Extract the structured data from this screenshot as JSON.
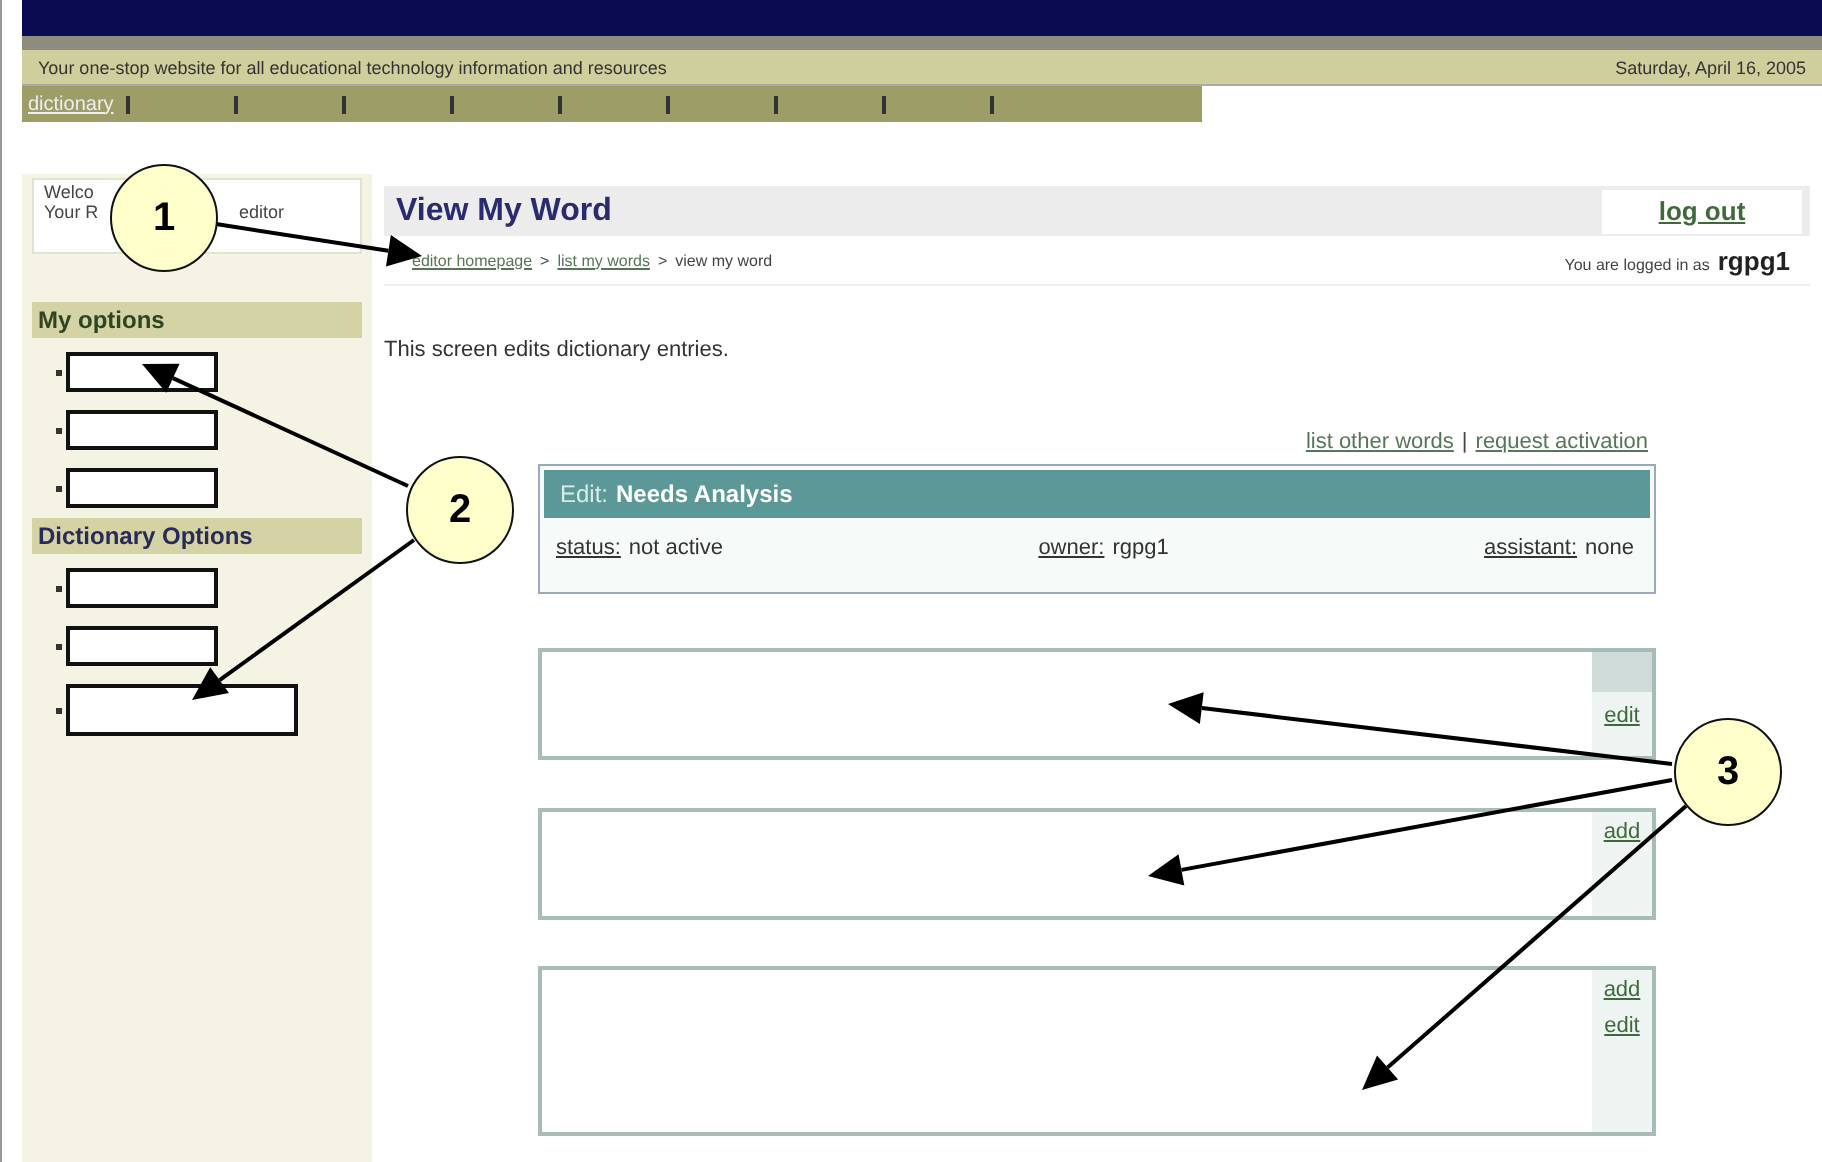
{
  "header": {
    "tagline": "Your one-stop website for all educational technology information and resources",
    "date": "Saturday, April 16, 2005"
  },
  "nav": {
    "items": [
      {
        "kind": "link",
        "label": "dictionary"
      },
      {
        "kind": "blank"
      },
      {
        "kind": "blank"
      },
      {
        "kind": "blank"
      },
      {
        "kind": "blank"
      },
      {
        "kind": "blank"
      },
      {
        "kind": "blank"
      },
      {
        "kind": "blank"
      },
      {
        "kind": "blank"
      }
    ]
  },
  "sidebar": {
    "welcome": {
      "line_1": "Welco",
      "line_2_start": "Your R",
      "line_2_end": "editor"
    },
    "sections": [
      {
        "title": "My options",
        "items": [
          {
            "kind": "blank"
          },
          {
            "kind": "blank"
          },
          {
            "kind": "blank"
          }
        ]
      },
      {
        "title": "Dictionary Options",
        "items": [
          {
            "kind": "blank"
          },
          {
            "kind": "blank"
          },
          {
            "kind": "blank_wide"
          }
        ]
      }
    ]
  },
  "main": {
    "title": "View My Word",
    "logout": "log out",
    "breadcrumb": {
      "separator": ">",
      "items": [
        {
          "label": "editor homepage",
          "kind": "link"
        },
        {
          "label": "list my words",
          "kind": "link"
        },
        {
          "label": "view my word",
          "kind": "current"
        }
      ]
    },
    "logged_in": {
      "prefix": "You are logged in as",
      "user": "rgpg1"
    },
    "intro": "This screen edits dictionary entries.",
    "links": {
      "separator": "|",
      "items": [
        "list other words",
        "request activation"
      ]
    },
    "edit_panel": {
      "prefix": "Edit:",
      "title": "Needs Analysis",
      "fields": [
        {
          "label": "status:",
          "value": "not active"
        },
        {
          "label": "owner:",
          "value": "rgpg1"
        },
        {
          "label": "assistant:",
          "value": "none"
        }
      ]
    },
    "entries": [
      {
        "actions": [
          {
            "kind": "shade"
          },
          {
            "kind": "link",
            "label": "edit"
          }
        ]
      },
      {
        "actions": [
          {
            "kind": "link",
            "label": "add"
          }
        ]
      },
      {
        "actions": [
          {
            "kind": "link",
            "label": "add"
          },
          {
            "kind": "link",
            "label": "edit"
          }
        ]
      }
    ]
  },
  "callouts": [
    {
      "label": "1"
    },
    {
      "label": "2"
    },
    {
      "label": "3"
    }
  ]
}
